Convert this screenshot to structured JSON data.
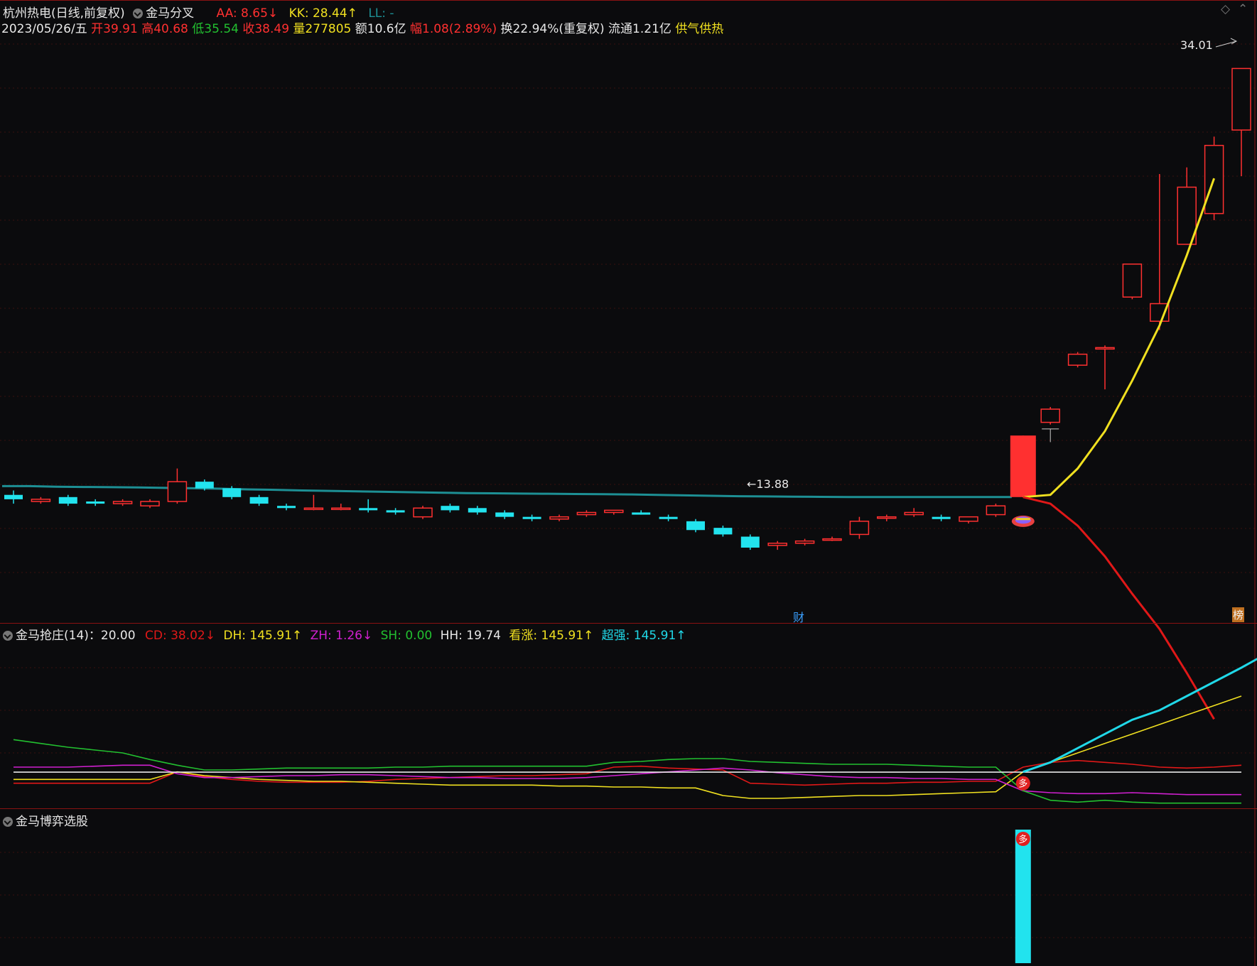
{
  "header": {
    "stock": "杭州热电(日线,前复权)",
    "indicator": "金马分叉",
    "aa_label": "AA: 8.65",
    "kk_label": "KK: 28.44",
    "ll_label": "LL: -",
    "date": "2023/05/26/五",
    "open": "开39.91",
    "high": "高40.68",
    "low": "低35.54",
    "close": "收38.49",
    "volume": "量277805",
    "amount": "额10.6亿",
    "change": "幅1.08(2.89%)",
    "turnover": "换22.94%(重复权)",
    "float": "流通1.21亿",
    "tag": "供气供热"
  },
  "panel2": {
    "title": "金马抢庄(14)：20.00",
    "cd": "CD: 38.02",
    "dh": "DH: 145.91",
    "zh": "ZH: 1.26",
    "sh": "SH: 0.00",
    "hh": "HH: 19.74",
    "kz": "看涨: 145.91",
    "cq": "超强: 145.91"
  },
  "panel3": {
    "title": "金马博弈选股"
  },
  "markers": {
    "cai": "财",
    "bang": "榜",
    "duo": "多",
    "high_label": "34.01",
    "low_label": "13.88"
  },
  "colors": {
    "up": "#ff3030",
    "down": "#22e3ee",
    "yellow": "#f0e020",
    "teal": "#1d8f94",
    "green": "#22c030",
    "magenta": "#d020d0",
    "white": "#e8e8e8",
    "red": "#e01818",
    "cyan": "#20d8e8"
  },
  "chart_data": [
    {
      "type": "candlestick",
      "title": "杭州热电(日线,前复权)",
      "ylim": [
        9,
        35.5
      ],
      "candles": [
        [
          14.6,
          14.8,
          14.2,
          14.4
        ],
        [
          14.3,
          14.5,
          14.2,
          14.4
        ],
        [
          14.5,
          14.6,
          14.1,
          14.2
        ],
        [
          14.3,
          14.4,
          14.1,
          14.2
        ],
        [
          14.2,
          14.4,
          14.1,
          14.3
        ],
        [
          14.1,
          14.4,
          14.0,
          14.3
        ],
        [
          14.3,
          15.8,
          14.2,
          15.2
        ],
        [
          15.2,
          15.3,
          14.8,
          14.9
        ],
        [
          14.9,
          15.0,
          14.4,
          14.5
        ],
        [
          14.5,
          14.6,
          14.1,
          14.2
        ],
        [
          14.1,
          14.2,
          13.9,
          14.0
        ],
        [
          14.0,
          14.6,
          13.9,
          14.0
        ],
        [
          14.0,
          14.2,
          13.9,
          14.0
        ],
        [
          14.0,
          14.4,
          13.8,
          13.9
        ],
        [
          13.9,
          14.0,
          13.7,
          13.8
        ],
        [
          13.6,
          14.1,
          13.5,
          14.0
        ],
        [
          14.1,
          14.2,
          13.8,
          13.9
        ],
        [
          14.0,
          14.1,
          13.7,
          13.8
        ],
        [
          13.8,
          13.9,
          13.5,
          13.6
        ],
        [
          13.6,
          13.7,
          13.4,
          13.5
        ],
        [
          13.5,
          13.7,
          13.4,
          13.6
        ],
        [
          13.7,
          13.9,
          13.6,
          13.8
        ],
        [
          13.8,
          13.9,
          13.7,
          13.9
        ],
        [
          13.8,
          13.9,
          13.7,
          13.7
        ],
        [
          13.6,
          13.7,
          13.4,
          13.5
        ],
        [
          13.4,
          13.5,
          12.9,
          13.0
        ],
        [
          13.1,
          13.2,
          12.7,
          12.8
        ],
        [
          12.7,
          12.8,
          12.1,
          12.2
        ],
        [
          12.3,
          12.5,
          12.1,
          12.4
        ],
        [
          12.4,
          12.6,
          12.3,
          12.5
        ],
        [
          12.6,
          12.7,
          12.5,
          12.6
        ],
        [
          12.8,
          13.6,
          12.6,
          13.4
        ],
        [
          13.6,
          13.7,
          13.4,
          13.6
        ],
        [
          13.7,
          14.0,
          13.6,
          13.8
        ],
        [
          13.6,
          13.7,
          13.4,
          13.5
        ],
        [
          13.4,
          13.6,
          13.3,
          13.6
        ],
        [
          13.7,
          14.2,
          13.6,
          14.1
        ],
        [
          14.5,
          17.3,
          14.5,
          17.3
        ],
        [
          17.9,
          18.6,
          17.8,
          18.5
        ],
        [
          20.5,
          21.1,
          20.4,
          21.0
        ],
        [
          21.3,
          21.4,
          19.4,
          21.3
        ],
        [
          23.6,
          25.1,
          23.5,
          25.1
        ],
        [
          22.5,
          29.2,
          22.1,
          23.3
        ],
        [
          26.0,
          29.5,
          26.0,
          28.6
        ],
        [
          27.4,
          30.9,
          27.1,
          30.5
        ],
        [
          31.2,
          34.01,
          29.1,
          34.0
        ]
      ],
      "kk_line": [
        15.0,
        15.0,
        14.97,
        14.96,
        14.95,
        14.94,
        14.92,
        14.9,
        14.88,
        14.85,
        14.83,
        14.8,
        14.78,
        14.76,
        14.74,
        14.72,
        14.7,
        14.68,
        14.67,
        14.66,
        14.65,
        14.64,
        14.63,
        14.62,
        14.6,
        14.58,
        14.56,
        14.54,
        14.53,
        14.52,
        14.51,
        14.5,
        14.5,
        14.5,
        14.5,
        14.5,
        14.5,
        14.5
      ],
      "aa_line_start_index": 37,
      "aa_line": [
        14.5,
        14.6,
        15.8,
        17.5,
        19.8,
        22.3,
        25.5,
        29.0
      ],
      "ll_line_start_index": 37,
      "ll_line": [
        14.5,
        14.2,
        13.2,
        11.8,
        10.1,
        8.5,
        6.5,
        4.4
      ]
    },
    {
      "type": "line",
      "title": "金马抢庄(14)",
      "series": [
        {
          "name": "CD",
          "values": [
            8,
            8,
            8,
            8,
            8,
            8,
            20,
            15,
            12,
            10,
            9,
            9,
            9,
            10,
            12,
            13,
            14,
            15,
            16,
            16,
            17,
            18,
            25,
            26,
            24,
            23,
            22,
            8,
            7,
            6,
            7,
            8,
            8,
            9,
            9,
            10,
            10,
            25,
            30,
            32,
            30,
            28,
            25,
            24,
            25,
            27
          ]
        },
        {
          "name": "DH",
          "values": [
            12,
            12,
            12,
            12,
            12,
            12,
            20,
            16,
            14,
            12,
            11,
            10,
            10,
            9,
            8,
            7,
            6,
            6,
            6,
            6,
            5,
            5,
            4,
            4,
            3,
            3,
            -5,
            -8,
            -8,
            -7,
            -6,
            -5,
            -5,
            -4,
            -3,
            -2,
            -1,
            20,
            30,
            40,
            50,
            60,
            70,
            80,
            90,
            100
          ]
        },
        {
          "name": "ZH",
          "values": [
            25,
            25,
            25,
            26,
            27,
            27,
            18,
            14,
            14,
            15,
            16,
            16,
            17,
            17,
            16,
            15,
            14,
            14,
            13,
            13,
            13,
            14,
            16,
            18,
            20,
            22,
            24,
            22,
            19,
            17,
            15,
            14,
            14,
            13,
            13,
            12,
            12,
            0,
            -2,
            -3,
            -3,
            -2,
            -3,
            -4,
            -4,
            -4
          ]
        },
        {
          "name": "SH",
          "values": [
            54,
            50,
            46,
            43,
            40,
            33,
            27,
            22,
            22,
            23,
            24,
            24,
            24,
            24,
            25,
            25,
            26,
            26,
            26,
            26,
            26,
            26,
            30,
            31,
            33,
            34,
            34,
            31,
            30,
            29,
            28,
            28,
            28,
            27,
            26,
            25,
            25,
            0,
            -10,
            -12,
            -10,
            -12,
            -13,
            -13,
            -13,
            -13
          ]
        },
        {
          "name": "HH",
          "values": [
            19.74,
            19.74,
            19.74,
            19.74,
            19.74,
            19.74,
            19.74,
            19.74,
            19.74,
            19.74,
            19.74,
            19.74,
            19.74,
            19.74,
            19.74,
            19.74,
            19.74,
            19.74,
            19.74,
            19.74,
            19.74,
            19.74,
            19.74,
            19.74,
            19.74,
            19.74,
            19.74,
            19.74,
            19.74,
            19.74,
            19.74,
            19.74,
            19.74,
            19.74,
            19.74,
            19.74,
            19.74,
            19.74,
            19.74,
            19.74,
            19.74,
            19.74,
            19.74,
            19.74,
            19.74,
            19.74
          ]
        },
        {
          "name": "看涨",
          "start_index": 37,
          "values": [
            20,
            30,
            45,
            60,
            75,
            85,
            100,
            115,
            130,
            145.91
          ]
        }
      ],
      "ylim": [
        -20,
        160
      ]
    },
    {
      "type": "bar",
      "title": "金马博弈选股",
      "signal_index": 37,
      "value": 1
    }
  ]
}
